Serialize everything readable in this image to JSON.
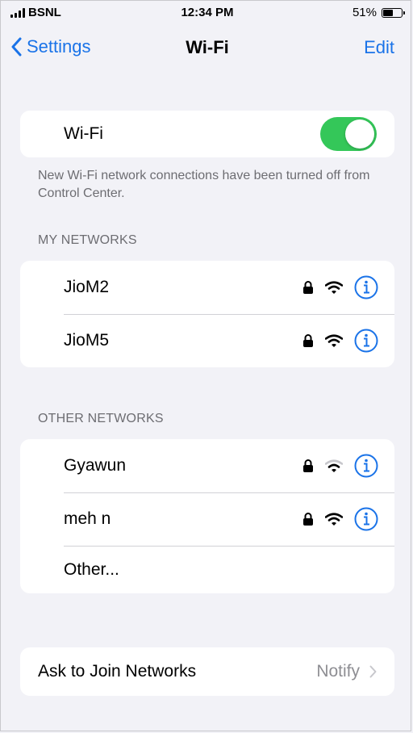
{
  "status_bar": {
    "carrier": "BSNL",
    "time": "12:34 PM",
    "battery": "51%",
    "battery_level": 0.51
  },
  "nav": {
    "back_label": "Settings",
    "title": "Wi-Fi",
    "edit_label": "Edit"
  },
  "wifi_toggle": {
    "label": "Wi-Fi",
    "on": true
  },
  "control_center_note": "New Wi-Fi network connections have been turned off from Control Center.",
  "my_networks": {
    "header": "MY NETWORKS",
    "items": [
      {
        "name": "JioM2",
        "secured": true,
        "signal": "strong"
      },
      {
        "name": "JioM5",
        "secured": true,
        "signal": "strong"
      }
    ]
  },
  "other_networks": {
    "header": "OTHER NETWORKS",
    "items": [
      {
        "name": "Gyawun",
        "secured": true,
        "signal": "weak"
      },
      {
        "name": "meh n",
        "secured": true,
        "signal": "strong"
      }
    ],
    "other_label": "Other..."
  },
  "ask_to_join": {
    "label": "Ask to Join Networks",
    "value": "Notify"
  },
  "colors": {
    "accent": "#1a73e8",
    "toggle_on": "#34c759",
    "background": "#f2f2f7",
    "secondary_text": "#6d6d72"
  },
  "icons": {
    "back": "chevron-left-icon",
    "lock": "lock-icon",
    "wifi": "wifi-icon",
    "info": "info-icon",
    "chevron": "chevron-right-icon"
  }
}
